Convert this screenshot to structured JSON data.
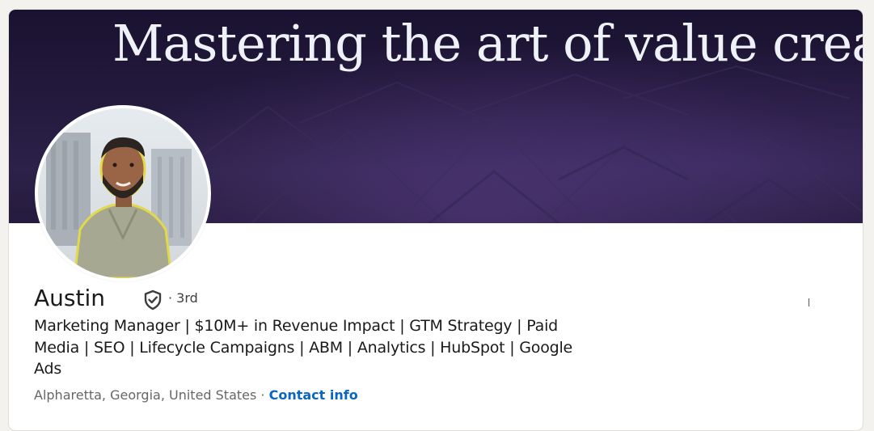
{
  "profile": {
    "banner_text": "Mastering the art of value creation",
    "name": "Austin",
    "degree": "· 3rd",
    "headline": "Marketing Manager | $10M+ in Revenue Impact | GTM Strategy | Paid Media | SEO | Lifecycle Campaigns | ABM | Analytics | HubSpot | Google Ads",
    "location": "Alpharetta, Georgia, United States",
    "separator": " · ",
    "contact_label": "Contact info"
  },
  "icons": {
    "verified": "shield-check-icon"
  },
  "colors": {
    "link": "#0a66c2",
    "banner": "#241a3e",
    "avatar_outline": "#e2d94a"
  }
}
